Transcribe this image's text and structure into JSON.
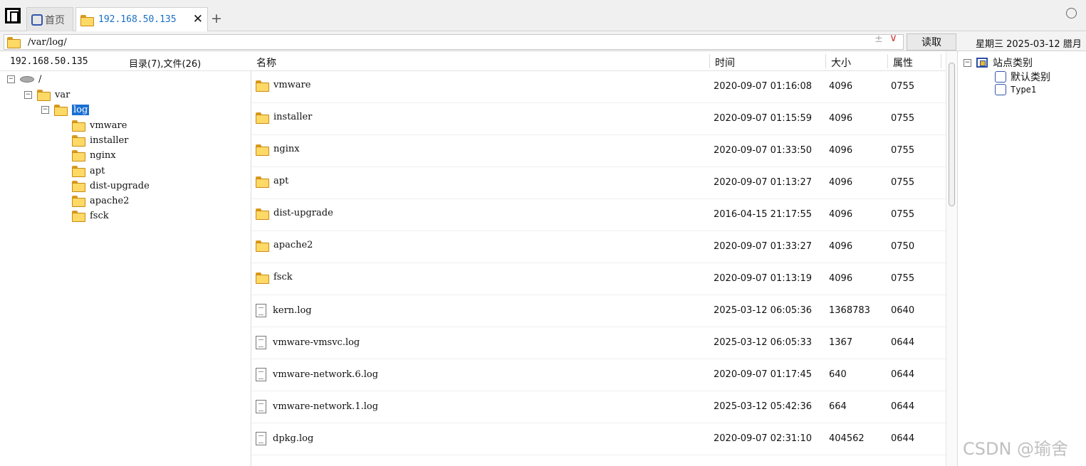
{
  "tabs": {
    "home_label": "首页",
    "host_label": "192.168.50.135",
    "close_glyph": "✕",
    "add_glyph": "+"
  },
  "address": {
    "path": "/var/log/",
    "pm_glyph": "±",
    "dropdown_glyph": "∨",
    "read_label": "读取"
  },
  "datebar": "星期三 2025-03-12 腊月",
  "left_panel": {
    "host": "192.168.50.135",
    "summary": "目录(7),文件(26)",
    "tree": [
      {
        "label": "/",
        "icon": "drive-icon",
        "expanded": true
      },
      {
        "label": "var",
        "icon": "folder-icon",
        "expanded": true
      },
      {
        "label": "log",
        "icon": "folder-icon",
        "expanded": true,
        "selected": true
      },
      {
        "label": "vmware",
        "icon": "folder-icon"
      },
      {
        "label": "installer",
        "icon": "folder-icon"
      },
      {
        "label": "nginx",
        "icon": "folder-icon"
      },
      {
        "label": "apt",
        "icon": "folder-icon"
      },
      {
        "label": "dist-upgrade",
        "icon": "folder-icon"
      },
      {
        "label": "apache2",
        "icon": "folder-icon"
      },
      {
        "label": "fsck",
        "icon": "folder-icon"
      }
    ]
  },
  "list": {
    "columns": {
      "name": "名称",
      "time": "时间",
      "size": "大小",
      "attr": "属性"
    },
    "rows": [
      {
        "type": "folder",
        "name": "vmware",
        "time": "2020-09-07 01:16:08",
        "size": "4096",
        "attr": "0755"
      },
      {
        "type": "folder",
        "name": "installer",
        "time": "2020-09-07 01:15:59",
        "size": "4096",
        "attr": "0755"
      },
      {
        "type": "folder",
        "name": "nginx",
        "time": "2020-09-07 01:33:50",
        "size": "4096",
        "attr": "0755"
      },
      {
        "type": "folder",
        "name": "apt",
        "time": "2020-09-07 01:13:27",
        "size": "4096",
        "attr": "0755"
      },
      {
        "type": "folder",
        "name": "dist-upgrade",
        "time": "2016-04-15 21:17:55",
        "size": "4096",
        "attr": "0755"
      },
      {
        "type": "folder",
        "name": "apache2",
        "time": "2020-09-07 01:33:27",
        "size": "4096",
        "attr": "0750"
      },
      {
        "type": "folder",
        "name": "fsck",
        "time": "2020-09-07 01:13:19",
        "size": "4096",
        "attr": "0755"
      },
      {
        "type": "file",
        "name": "kern.log",
        "time": "2025-03-12 06:05:36",
        "size": "1368783",
        "attr": "0640"
      },
      {
        "type": "file",
        "name": "vmware-vmsvc.log",
        "time": "2025-03-12 06:05:33",
        "size": "1367",
        "attr": "0644"
      },
      {
        "type": "file",
        "name": "vmware-network.6.log",
        "time": "2020-09-07 01:17:45",
        "size": "640",
        "attr": "0644"
      },
      {
        "type": "file",
        "name": "vmware-network.1.log",
        "time": "2025-03-12 05:42:36",
        "size": "664",
        "attr": "0644"
      },
      {
        "type": "file",
        "name": "dpkg.log",
        "time": "2020-09-07 02:31:10",
        "size": "404562",
        "attr": "0644"
      }
    ]
  },
  "right_panel": {
    "root_label": "站点类别",
    "items": [
      "默认类别",
      "Type1"
    ]
  },
  "watermark": "CSDN @瑜舍"
}
